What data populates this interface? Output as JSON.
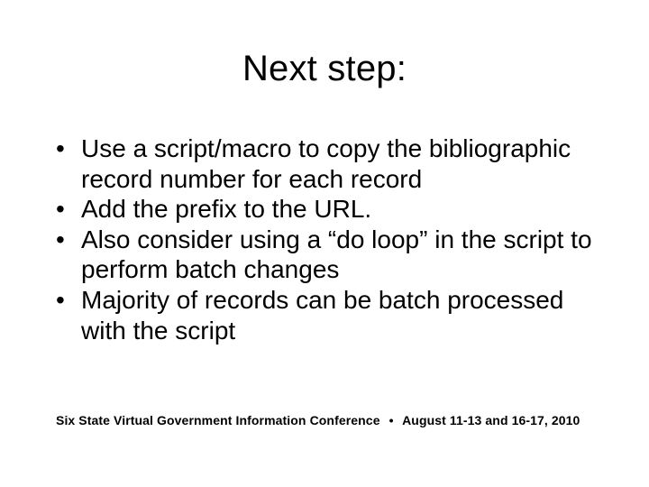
{
  "title": "Next step:",
  "bullets": [
    "Use a script/macro to copy the bibliographic record number for each record",
    "Add the prefix to the URL.",
    "Also consider using a “do loop” in the script to perform batch changes",
    "Majority of records can be batch processed with the script"
  ],
  "footer": {
    "left": "Six State Virtual Government Information Conference",
    "separator": "•",
    "right": "August 11-13 and 16-17, 2010"
  }
}
